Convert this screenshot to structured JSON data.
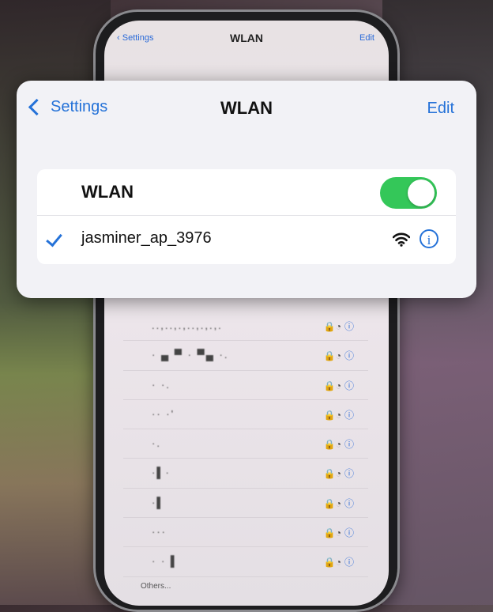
{
  "phone": {
    "nav": {
      "back_label": "Settings",
      "title": "WLAN",
      "edit_label": "Edit"
    },
    "networks": [
      {
        "ssid": "..,..,.,..,.,.,."
      },
      {
        "ssid": "· ▄ ▀ · ▀▄ ·."
      },
      {
        "ssid": "· ·."
      },
      {
        "ssid": "·· ·'"
      },
      {
        "ssid": "·."
      },
      {
        "ssid": "·▌·"
      },
      {
        "ssid": "·▌"
      },
      {
        "ssid": "···"
      },
      {
        "ssid": "· · ▌"
      }
    ],
    "others_label": "Others..."
  },
  "popup": {
    "back_label": "Settings",
    "title": "WLAN",
    "edit_label": "Edit",
    "wlan_label": "WLAN",
    "wlan_enabled": true,
    "connected_network": "jasminer_ap_3976",
    "info_glyph": "i"
  },
  "colors": {
    "accent": "#2572d8",
    "toggle_on": "#34c759"
  }
}
